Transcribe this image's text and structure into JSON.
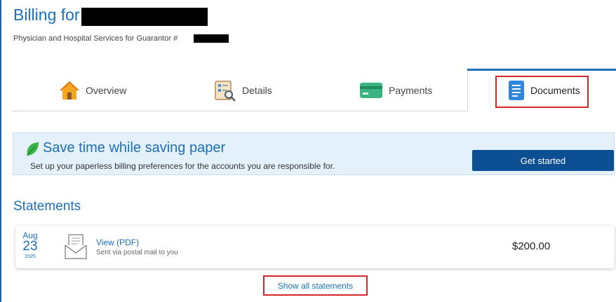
{
  "header": {
    "title": "Billing for",
    "subtitle": "Physician and Hospital Services for Guarantor #"
  },
  "tabs": [
    {
      "label": "Overview",
      "icon": "house-icon"
    },
    {
      "label": "Details",
      "icon": "magnifier-document-icon"
    },
    {
      "label": "Payments",
      "icon": "credit-card-icon"
    },
    {
      "label": "Documents",
      "icon": "document-icon",
      "active": true
    }
  ],
  "banner": {
    "headline": "Save time while saving paper",
    "description": "Set up your paperless billing preferences for the accounts you are responsible for.",
    "button_label": "Get started",
    "icon": "leaf-icon"
  },
  "statements": {
    "title": "Statements",
    "items": [
      {
        "month": "Aug",
        "day": "23",
        "year": "2025",
        "link_label": "View (PDF)",
        "note": "Sent via postal mail to you",
        "amount": "$200.00",
        "icon": "envelope-icon"
      }
    ],
    "show_all_label": "Show all statements"
  },
  "colors": {
    "accent": "#1d6fb8",
    "button": "#0c4f93",
    "banner_bg": "#e4f1fb",
    "highlight_box": "#d62828"
  }
}
